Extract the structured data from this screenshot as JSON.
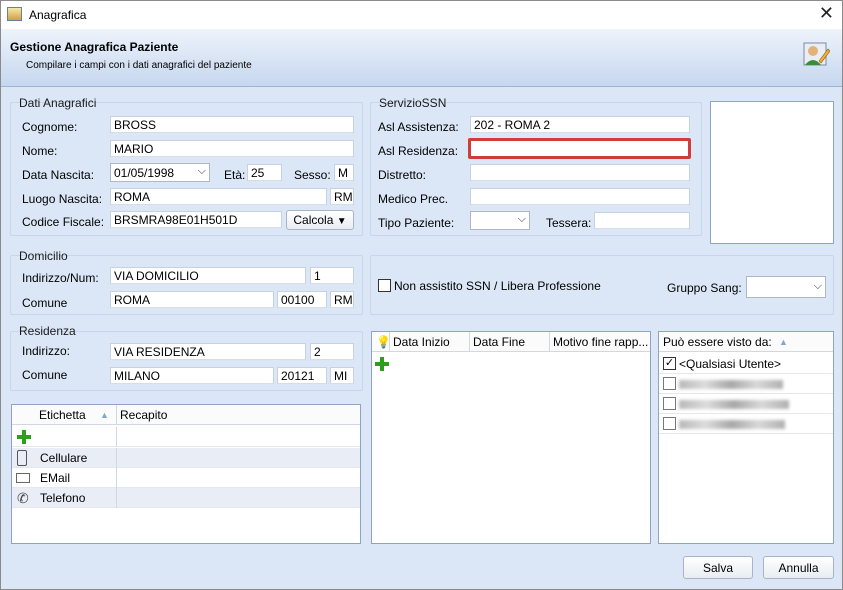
{
  "window": {
    "title": "Anagrafica"
  },
  "header": {
    "title": "Gestione Anagrafica Paziente",
    "subtitle": "Compilare i campi con i dati anagrafici del paziente"
  },
  "dati": {
    "group_label": "Dati Anagrafici",
    "cognome_label": "Cognome:",
    "cognome": "BROSS",
    "nome_label": "Nome:",
    "nome": "MARIO",
    "nascita_label": "Data Nascita:",
    "nascita": "01/05/1998",
    "eta_label": "Età:",
    "eta": "25",
    "sesso_label": "Sesso:",
    "sesso": "M",
    "luogo_label": "Luogo Nascita:",
    "luogo": "ROMA",
    "luogo_prov": "RM",
    "cf_label": "Codice Fiscale:",
    "cf": "BRSMRA98E01H501D",
    "calcola": "Calcola"
  },
  "ssn": {
    "group_label": "ServizioSSN",
    "asl_assistenza_label": "Asl Assistenza:",
    "asl_assistenza": "202 - ROMA 2",
    "asl_residenza_label": "Asl Residenza:",
    "asl_residenza": "",
    "distretto_label": "Distretto:",
    "distretto": "",
    "medico_label": "Medico Prec.",
    "medico": "",
    "tipo_label": "Tipo Paziente:",
    "tipo": "",
    "tessera_label": "Tessera:",
    "tessera": ""
  },
  "domicilio": {
    "group_label": "Domicilio",
    "indirizzo_label": "Indirizzo/Num:",
    "indirizzo": "VIA DOMICILIO",
    "num": "1",
    "comune_label": "Comune",
    "comune": "ROMA",
    "cap": "00100",
    "prov": "RM"
  },
  "residenza": {
    "group_label": "Residenza",
    "indirizzo_label": "Indirizzo:",
    "indirizzo": "VIA RESIDENZA",
    "num": "2",
    "comune_label": "Comune",
    "comune": "MILANO",
    "cap": "20121",
    "prov": "MI"
  },
  "opzioni": {
    "non_assistito": "Non assistito SSN / Libera Professione",
    "gruppo_label": "Gruppo Sang:",
    "gruppo": ""
  },
  "recapiti": {
    "col_etichetta": "Etichetta",
    "col_recapito": "Recapito",
    "rows": [
      {
        "etichetta": "Cellulare",
        "icon": "phone-icon"
      },
      {
        "etichetta": "EMail",
        "icon": "mail-icon"
      },
      {
        "etichetta": "Telefono",
        "icon": "handset-icon"
      }
    ]
  },
  "periodi": {
    "col_inizio": "Data Inizio",
    "col_fine": "Data Fine",
    "col_motivo": "Motivo fine rapp..."
  },
  "visibilita": {
    "col_header": "Può essere visto da:",
    "items": [
      {
        "label": "<Qualsiasi Utente>",
        "checked": true
      }
    ]
  },
  "footer": {
    "salva": "Salva",
    "annulla": "Annulla"
  }
}
